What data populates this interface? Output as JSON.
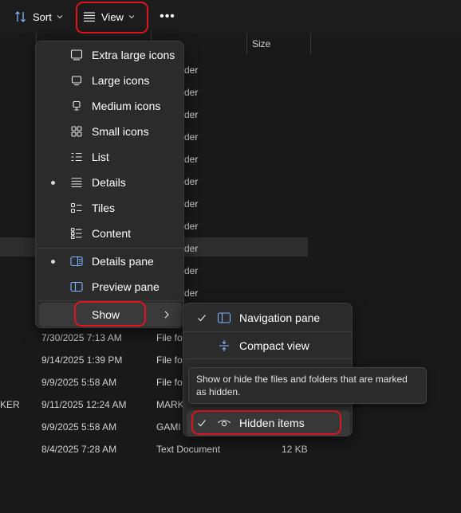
{
  "toolbar": {
    "sort_label": "Sort",
    "view_label": "View",
    "more_label": "•••",
    "icons": [
      "sort-icon",
      "view-lines-icon",
      "chevron-down-icon",
      "more-icon"
    ]
  },
  "columns": {
    "size": "Size"
  },
  "files": {
    "type_fragments": [
      "der",
      "der",
      "der",
      "der",
      "der",
      "der",
      "der",
      "der",
      "der",
      "der",
      "der"
    ],
    "rows": [
      {
        "name_fragment": "",
        "date": "7/30/2025 7:13 AM",
        "type": "File fo",
        "size": ""
      },
      {
        "name_fragment": "",
        "date": "9/14/2025 1:39 PM",
        "type": "File fo",
        "size": ""
      },
      {
        "name_fragment": "",
        "date": "9/9/2025 5:58 AM",
        "type": "File fo",
        "size": ""
      },
      {
        "name_fragment": "KER",
        "date": "9/11/2025 12:24 AM",
        "type": "MARK",
        "size": ""
      },
      {
        "name_fragment": "",
        "date": "9/9/2025 5:58 AM",
        "type": "GAMI",
        "size": ""
      },
      {
        "name_fragment": "",
        "date": "8/4/2025 7:28 AM",
        "type": "Text Document",
        "size": "12 KB"
      }
    ]
  },
  "view_menu": {
    "items": [
      {
        "label": "Extra large icons",
        "icon": "monitor-icon",
        "selected": false
      },
      {
        "label": "Large icons",
        "icon": "monitor-small-icon",
        "selected": false
      },
      {
        "label": "Medium icons",
        "icon": "monitor-stand-icon",
        "selected": false
      },
      {
        "label": "Small icons",
        "icon": "grid-icon",
        "selected": false
      },
      {
        "label": "List",
        "icon": "list-icon",
        "selected": false
      },
      {
        "label": "Details",
        "icon": "details-icon",
        "selected": true
      },
      {
        "label": "Tiles",
        "icon": "tiles-icon",
        "selected": false
      },
      {
        "label": "Content",
        "icon": "content-icon",
        "selected": false
      },
      {
        "label": "Details pane",
        "icon": "details-pane-icon",
        "selected": true
      },
      {
        "label": "Preview pane",
        "icon": "preview-pane-icon",
        "selected": false
      },
      {
        "label": "Show",
        "icon": "chevron-right-icon",
        "selected": false
      }
    ]
  },
  "show_menu": {
    "items": [
      {
        "label": "Navigation pane",
        "checked": true,
        "icon": "navigation-pane-icon"
      },
      {
        "label": "Compact view",
        "checked": false,
        "icon": "compact-view-icon"
      },
      {
        "label": "Hidden items",
        "checked": true,
        "icon": "eye-icon"
      }
    ]
  },
  "tooltip": {
    "text": "Show or hide the files and folders that are marked as hidden."
  },
  "colors": {
    "background": "#191919",
    "menu": "#2b2b2b",
    "highlight_ring": "#e0141f"
  }
}
